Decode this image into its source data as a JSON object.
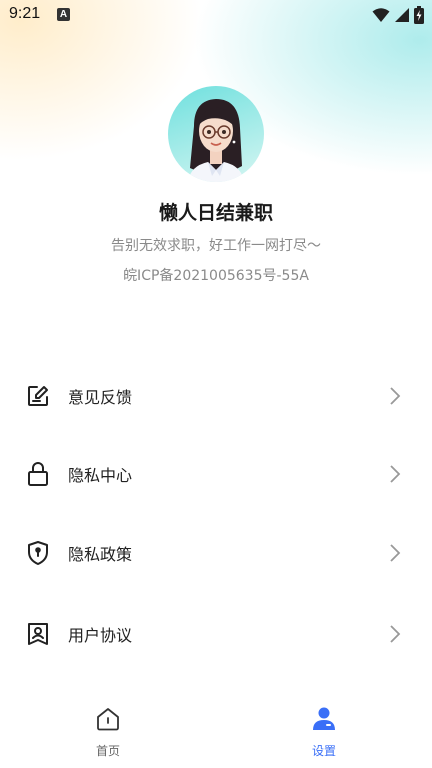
{
  "status_bar": {
    "time": "9:21",
    "notification_letter": "A"
  },
  "profile": {
    "app_name": "懒人日结兼职",
    "slogan": "告别无效求职，好工作一网打尽～",
    "icp": "皖ICP备2021005635号-55A"
  },
  "menu": {
    "items": [
      {
        "label": "意见反馈",
        "icon": "feedback-icon"
      },
      {
        "label": "隐私中心",
        "icon": "lock-icon"
      },
      {
        "label": "隐私政策",
        "icon": "shield-icon"
      },
      {
        "label": "用户协议",
        "icon": "user-agreement-icon"
      }
    ]
  },
  "tabbar": {
    "tabs": [
      {
        "label": "首页",
        "icon": "home-icon",
        "active": false
      },
      {
        "label": "设置",
        "icon": "user-profile-icon",
        "active": true
      }
    ]
  },
  "colors": {
    "accent": "#3a6ff7",
    "muted_text": "#8a8a8a"
  }
}
